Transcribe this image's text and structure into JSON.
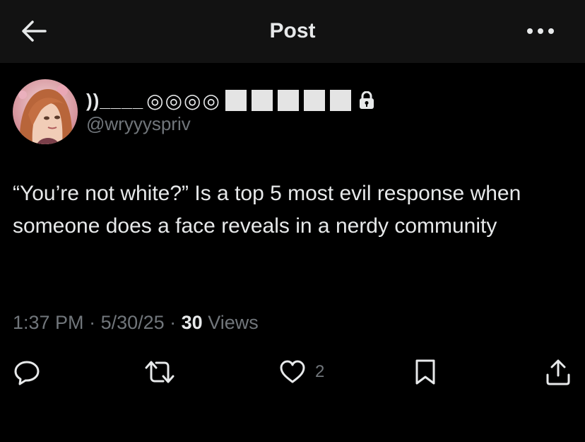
{
  "header": {
    "title": "Post",
    "back_icon": "arrow-left-icon",
    "more_icon": "more-horizontal-icon",
    "background": "#121212"
  },
  "author": {
    "display_name_prefix": "))____",
    "display_name_circles": "◎◎◎◎",
    "display_name_blocks": 5,
    "handle": "@wryyyspriv",
    "locked": true,
    "lock_icon": "lock-icon"
  },
  "tweet": {
    "text": "“You’re not white?” Is a top 5 most evil response when someone does a face reveals in a nerdy community"
  },
  "meta": {
    "time": "1:37 PM",
    "separator1": " · ",
    "date": "5/30/25",
    "separator2": " · ",
    "views_count": "30",
    "views_label": " Views"
  },
  "actions": {
    "reply_icon": "reply-icon",
    "retweet_icon": "retweet-icon",
    "like_icon": "heart-icon",
    "like_count": "2",
    "bookmark_icon": "bookmark-icon",
    "share_icon": "share-icon"
  },
  "colors": {
    "background": "#000000",
    "text": "#e7e9ea",
    "secondary": "#71767b"
  }
}
